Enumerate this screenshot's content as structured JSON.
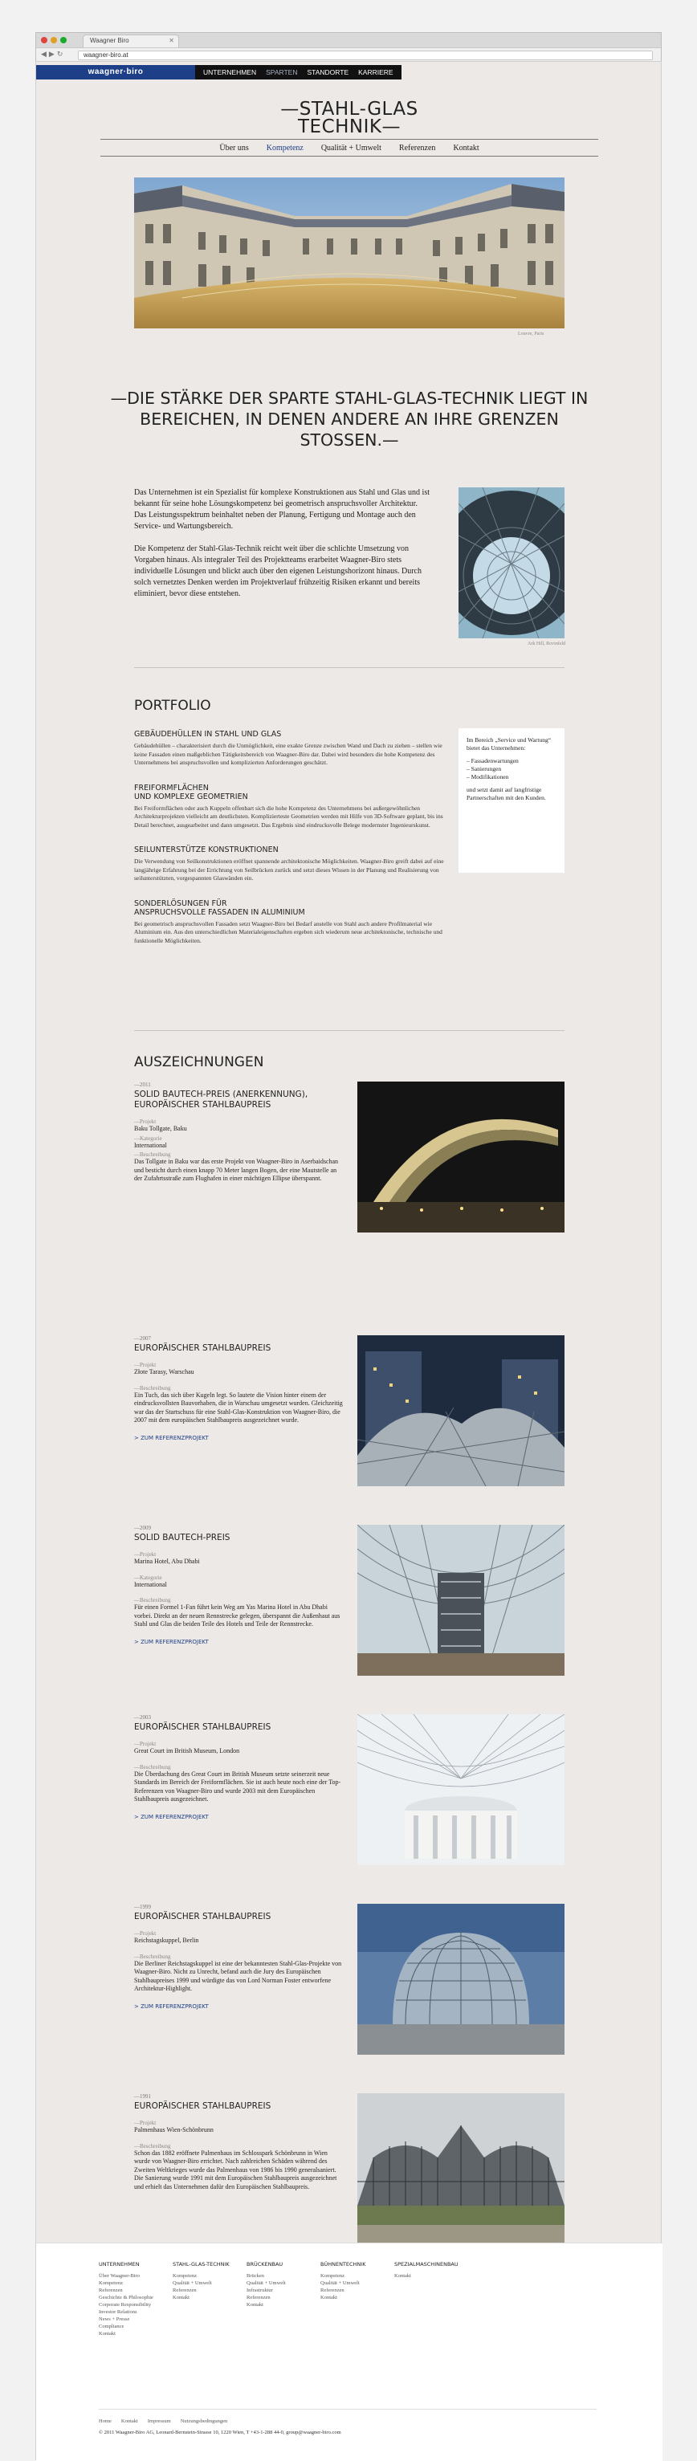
{
  "browser": {
    "tab_title": "Waagner Biro",
    "url": "waagner-biro.at"
  },
  "topnav": {
    "logo": "waagner·biro",
    "items": [
      "UNTERNEHMEN",
      "SPARTEN",
      "STANDORTE",
      "KARRIERE"
    ],
    "active": "SPARTEN"
  },
  "header": {
    "title_line1": "—STAHL-GLAS",
    "title_line2": "TECHNIK—",
    "subnav": [
      "Über uns",
      "Kompetenz",
      "Qualität + Umwelt",
      "Referenzen",
      "Kontakt"
    ],
    "subnav_active": "Kompetenz"
  },
  "hero": {
    "caption": "Louvre, Paris"
  },
  "quote": "—DIE STÄRKE DER SPARTE STAHL-GLAS-TECHNIK LIEGT IN BEREICHEN, IN DENEN ANDERE AN IHRE GRENZEN STOSSEN.—",
  "intro": {
    "p1": "Das Unternehmen ist ein Spezialist für komplexe Konstruktionen aus Stahl und Glas und ist bekannt für seine hohe Lösungskompetenz bei geometrisch anspruchsvoller Architektur. Das Leistungsspektrum beinhaltet neben der Planung, Fertigung und Montage auch den Service- und Wartungsbereich.",
    "p2": "Die Kompetenz der Stahl-Glas-Technik reicht weit über die schlichte Umsetzung von Vorgaben hinaus. Als integraler Teil des Projektteams erarbeitet Waagner-Biro stets individuelle Lösungen und blickt auch über den eigenen Leistungshorizont hinaus. Durch solch vernetztes Denken werden im Projektverlauf frühzeitig Risiken erkannt und bereits eliminiert, bevor diese entstehen.",
    "image_caption": "Ark Hill, Rovinfeld"
  },
  "portfolio": {
    "heading": "PORTFOLIO",
    "items": [
      {
        "title": "GEBÄUDEHÜLLEN IN STAHL UND GLAS",
        "body": "Gebäudehüllen – charakterisiert durch die Unmöglichkeit, eine exakte Grenze zwischen Wand und Dach zu ziehen – stellen wie keine Fassaden einen maßgeblichen Tätigkeitsbereich von Waagner-Biro dar. Dabei wird besonders die hohe Kompetenz des Unternehmens bei anspruchsvollen und komplizierten Anforderungen geschätzt."
      },
      {
        "title": "FREIFORMFLÄCHEN\nUND KOMPLEXE GEOMETRIEN",
        "body": "Bei Freiformflächen oder auch Kuppeln offenbart sich die hohe Kompetenz des Unternehmens bei außergewöhnlichen Architekturprojekten vielleicht am deutlichsten. Komplizierteste Geometrien werden mit Hilfe von 3D-Software geplant, bis ins Detail berechnet, ausgearbeitet und dann umgesetzt. Das Ergebnis sind eindrucksvolle Belege modernster Ingenieurskunst."
      },
      {
        "title": "SEILUNTERSTÜTZE KONSTRUKTIONEN",
        "body": "Die Verwendung von Seilkonstruktionen eröffnet spannende architektonische Möglichkeiten. Waagner-Biro greift dabei auf eine langjährige Erfahrung bei der Errichtung von Seilbrücken zurück und setzt dieses Wissen in der Planung und Realisierung von seilunterstützten, vorgespannten Glaswänden ein."
      },
      {
        "title": "SONDERLÖSUNGEN FÜR\nANSPRUCHSVOLLE FASSADEN IN ALUMINIUM",
        "body": "Bei geometrisch anspruchsvollen Fassaden setzt Waagner-Biro bei Bedarf anstelle von Stahl auch andere Profilmaterial wie Aluminium ein. Aus den unterschiedlichen Materialeigenschaften ergeben sich wiederum neue architektonische, technische und funktionelle Möglichkeiten."
      }
    ],
    "box": {
      "intro": "Im Bereich „Service und Wartung“ bietet das Unternehmen:",
      "list": [
        "– Fassadenwartungen",
        "– Sanierungen",
        "– Modifikationen"
      ],
      "outro": "und setzt damit auf langfristige Partnerschaften mit den Kunden."
    }
  },
  "awards": {
    "heading": "AUSZEICHNUNGEN",
    "link_label": "> ZUM REFERENZPROJEKT",
    "items": [
      {
        "year": "—2011",
        "title": "SOLID BAUTECH-PREIS (ANERKENNUNG),\nEUROPÄISCHER STAHLBAUPREIS",
        "fields": [
          {
            "label": "—Projekt",
            "value": "Baku Tollgate, Baku"
          },
          {
            "label": "—Kategorie",
            "value": "International"
          },
          {
            "label": "—Beschreibung",
            "value": "Das Tollgate in Baku war das erste Projekt von Waagner-Biro in Aserbaidschan und besticht durch einen knapp 70 Meter langen Bogen, der eine Mautstelle an der Zufahrtsstraße zum Flughafen in einer mächtigen Ellipse überspannt."
          }
        ],
        "has_link": false
      },
      {
        "year": "—2007",
        "title": "EUROPÄISCHER STAHLBAUPREIS",
        "fields": [
          {
            "label": "—Projekt",
            "value": "Złote Tarasy, Warschau"
          },
          {
            "label": "—Beschreibung",
            "value": "Ein Tuch, das sich über Kugeln legt. So lautete die Vision hinter einem der eindrucksvollsten Bauvorhaben, die in Warschau umgesetzt wurden. Gleichzeitig war das der Startschuss für eine Stahl-Glas-Konstruktion von Waagner-Biro, die 2007 mit dem europäischen Stahlbaupreis ausgezeichnet wurde."
          }
        ],
        "has_link": true
      },
      {
        "year": "—2009",
        "title": "SOLID BAUTECH-PREIS",
        "fields": [
          {
            "label": "—Projekt",
            "value": "Marina Hotel, Abu Dhabi"
          },
          {
            "label": "—Kategorie",
            "value": "International"
          },
          {
            "label": "—Beschreibung",
            "value": "Für einen Formel 1-Fan führt kein Weg am Yas Marina Hotel in Abu Dhabi vorbei. Direkt an der neuen Rennstrecke gelegen, überspannt die Außenhaut aus Stahl und Glas die beiden Teile des Hotels und Teile der Rennstrecke."
          }
        ],
        "has_link": true
      },
      {
        "year": "—2003",
        "title": "EUROPÄISCHER STAHLBAUPREIS",
        "fields": [
          {
            "label": "—Projekt",
            "value": "Great Court im British Museum, London"
          },
          {
            "label": "—Beschreibung",
            "value": "Die Überdachung des Great Court im British Museum setzte seinerzeit neue Standards im Bereich der Freiformflächen. Sie ist auch heute noch eine der Top-Referenzen von Waagner-Biro und wurde 2003 mit dem Europäischen Stahlbaupreis ausgezeichnet."
          }
        ],
        "has_link": true
      },
      {
        "year": "—1999",
        "title": "EUROPÄISCHER STAHLBAUPREIS",
        "fields": [
          {
            "label": "—Projekt",
            "value": "Reichstagskuppel, Berlin"
          },
          {
            "label": "—Beschreibung",
            "value": "Die Berliner Reichstagskuppel ist eine der bekanntesten Stahl-Glas-Projekte von Waagner-Biro. Nicht zu Unrecht, befand auch die Jury des Europäischen Stahlbaupreises 1999 und würdigte das von Lord Norman Foster entworfene Architektur-Highlight."
          }
        ],
        "has_link": true
      },
      {
        "year": "—1991",
        "title": "EUROPÄISCHER STAHLBAUPREIS",
        "fields": [
          {
            "label": "—Projekt",
            "value": "Palmenhaus Wien-Schönbrunn"
          },
          {
            "label": "—Beschreibung",
            "value": "Schon das 1882 eröffnete Palmenhaus im Schlosspark Schönbrunn in Wien wurde von Waagner-Biro errichtet. Nach zahlreichen Schäden während des Zweiten Weltkrieges wurde das Palmenhaus von 1986 bis 1990 generalsaniert. Die Sanierung wurde 1991 mit dem Europäischen Stahlbaupreis ausgezeichnet und erhielt das Unternehmen dafür den Europäischen Stahlbaupreis."
          }
        ],
        "has_link": false
      }
    ]
  },
  "footer": {
    "columns": [
      {
        "title": "UNTERNEHMEN",
        "items": [
          "Über Waagner-Biro",
          "Kompetenz",
          "Referenzen",
          "Geschichte & Philosophie",
          "Corporate Responsibility",
          "Investor Relations",
          "News + Presse",
          "Compliance",
          "Kontakt"
        ]
      },
      {
        "title": "STAHL-GLAS-TECHNIK",
        "items": [
          "Kompetenz",
          "Qualität + Umwelt",
          "Referenzen",
          "Kontakt"
        ]
      },
      {
        "title": "BRÜCKENBAU",
        "items": [
          "Brücken",
          "Qualität + Umwelt",
          "Infrastruktur",
          "Referenzen",
          "Kontakt"
        ]
      },
      {
        "title": "BÜHNENTECHNIK",
        "items": [
          "Kompetenz",
          "Qualität + Umwelt",
          "Referenzen",
          "Kontakt"
        ]
      },
      {
        "title": "SPEZIALMASCHINENBAU",
        "items": [
          "Kontakt"
        ]
      }
    ],
    "links": [
      "Home",
      "Kontakt",
      "Impressum",
      "Nutzungsbedingungen"
    ],
    "copyright": "© 2011 Waagner-Biro AG, Leonard-Bernstein-Strasse 10, 1220 Wien, T +43-1-288 44-0, group@waagner-biro.com"
  }
}
